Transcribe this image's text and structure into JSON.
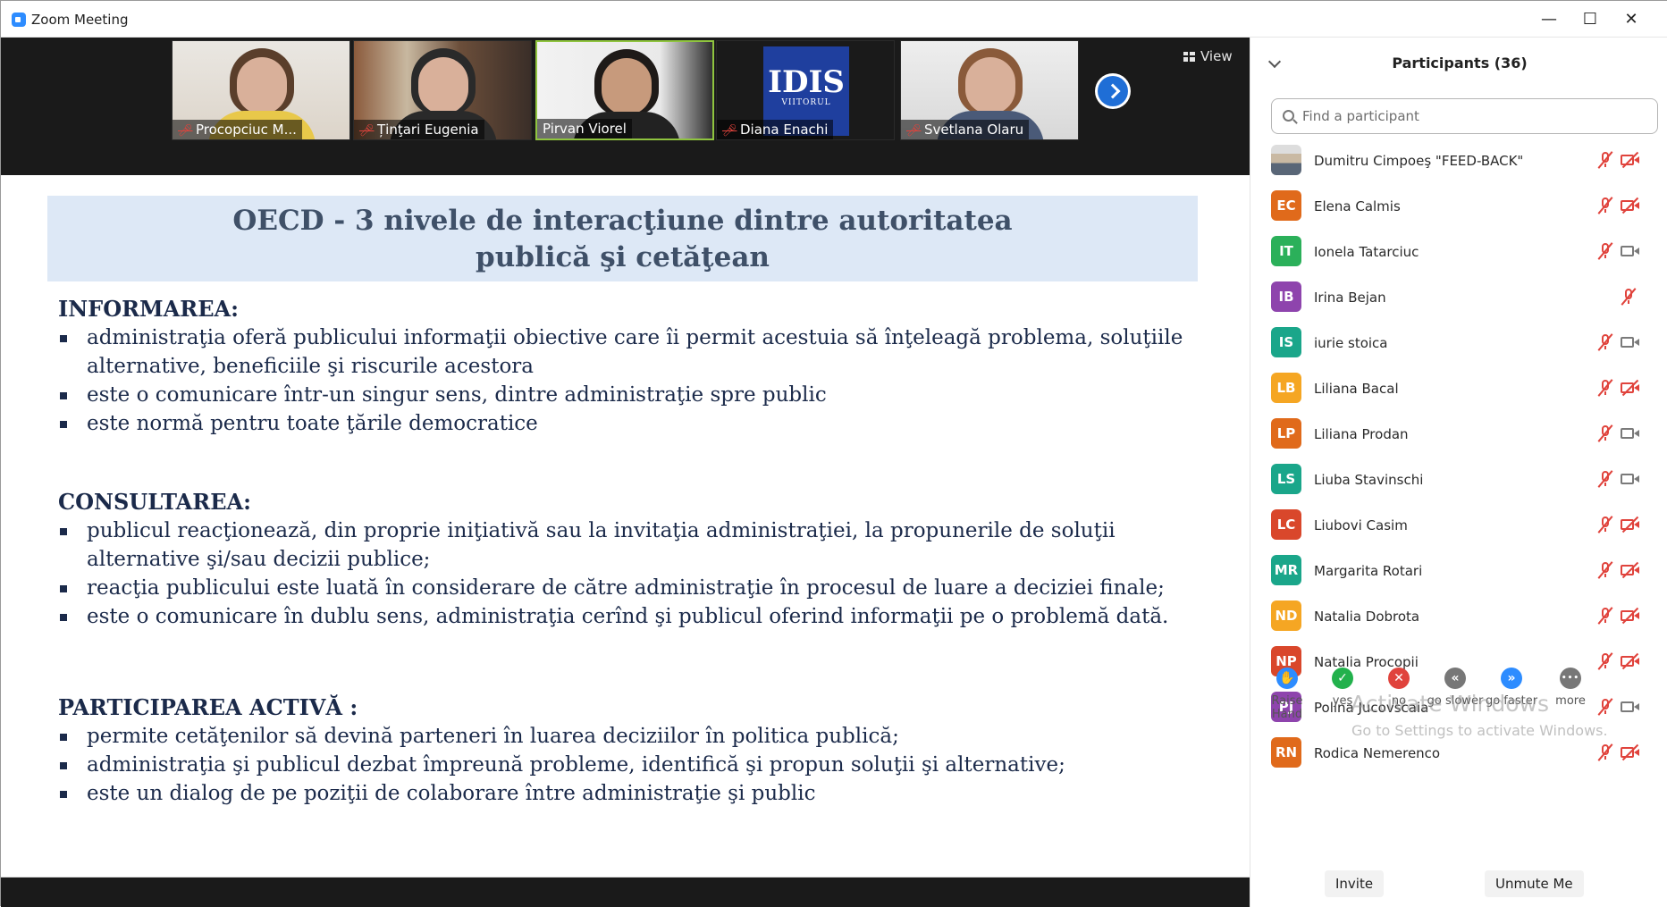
{
  "window": {
    "title": "Zoom Meeting",
    "minimize": "—",
    "maximize": "☐",
    "close": "✕"
  },
  "video_strip": {
    "view_label": "View",
    "tiles": [
      {
        "name": "Procopciuc M...",
        "muted": true
      },
      {
        "name": "Ținţari Eugenia",
        "muted": true
      },
      {
        "name": "Pirvan Viorel",
        "muted": false,
        "active": true
      },
      {
        "name": "Diana Enachi",
        "muted": true
      },
      {
        "name": "Svetlana Olaru",
        "muted": true
      }
    ],
    "logo_text": "IDIS",
    "logo_subtext": "VIITORUL"
  },
  "slide": {
    "title_line1": "OECD - 3 nivele de interacţiune dintre autoritatea",
    "title_line2": "publică şi cetăţean",
    "sections": [
      {
        "heading": "INFORMAREA:",
        "bullets": [
          "administraţia oferă publicului informaţii obiective care îi permit acestuia să înţeleagă problema, soluţiile alternative, beneficiile şi riscurile acestora",
          "este o comunicare într-un singur sens, dintre administraţie spre public",
          "este normă pentru toate ţările democratice"
        ]
      },
      {
        "heading": "CONSULTAREA:",
        "bullets": [
          "publicul reacţionează, din proprie iniţiativă sau la invitaţia administraţiei, la propunerile de soluţii alternative şi/sau decizii publice;",
          "reacţia publicului este luată în considerare de către administraţie în procesul de luare a deciziei finale;",
          "este o comunicare în dublu sens, administraţia cerînd şi publicul oferind informaţii pe o problemă dată."
        ]
      },
      {
        "heading": "PARTICIPAREA ACTIVĂ :",
        "bullets": [
          "permite cetăţenilor să devină parteneri în luarea deciziilor în politica publică;",
          "administraţia şi publicul dezbat împreună probleme, identifică şi propun soluţii şi alternative;",
          "este un dialog de pe poziţii de colaborare între administraţie şi public"
        ]
      }
    ]
  },
  "participants": {
    "title": "Participants (36)",
    "search_placeholder": "Find a participant",
    "list": [
      {
        "initials": "",
        "name": "Dumitru Cimpoeş \"FEED-BACK\"",
        "color": "#888888",
        "photo": true,
        "mic_muted": true,
        "cam": "off"
      },
      {
        "initials": "EC",
        "name": "Elena Calmis",
        "color": "#e06a1b",
        "mic_muted": true,
        "cam": "off"
      },
      {
        "initials": "IT",
        "name": "Ionela Tatarciuc",
        "color": "#2bb05a",
        "mic_muted": true,
        "cam": "on"
      },
      {
        "initials": "IB",
        "name": "Irina Bejan",
        "color": "#8e44ad",
        "mic_muted": true,
        "cam": "none"
      },
      {
        "initials": "IS",
        "name": "iurie stoica",
        "color": "#1aa68a",
        "mic_muted": true,
        "cam": "on"
      },
      {
        "initials": "LB",
        "name": "Liliana Bacal",
        "color": "#f5a623",
        "mic_muted": true,
        "cam": "off"
      },
      {
        "initials": "LP",
        "name": "Liliana Prodan",
        "color": "#e06a1b",
        "mic_muted": true,
        "cam": "on"
      },
      {
        "initials": "LS",
        "name": "Liuba Stavinschi",
        "color": "#1aa68a",
        "mic_muted": true,
        "cam": "on"
      },
      {
        "initials": "LC",
        "name": "Liubovi Casim",
        "color": "#d9472b",
        "mic_muted": true,
        "cam": "off"
      },
      {
        "initials": "MR",
        "name": "Margarita Rotari",
        "color": "#1aa68a",
        "mic_muted": true,
        "cam": "off"
      },
      {
        "initials": "ND",
        "name": "Natalia Dobrota",
        "color": "#f5a623",
        "mic_muted": true,
        "cam": "off"
      },
      {
        "initials": "NP",
        "name": "Natalia Procopii",
        "color": "#d9472b",
        "mic_muted": true,
        "cam": "off"
      },
      {
        "initials": "PJ",
        "name": "Polina Jucovscaia",
        "color": "#8e44ad",
        "mic_muted": true,
        "cam": "on"
      },
      {
        "initials": "RN",
        "name": "Rodica Nemerenco",
        "color": "#e06a1b",
        "mic_muted": true,
        "cam": "off"
      }
    ],
    "reactions": [
      {
        "label": "Raise Hand",
        "icon": "raise-hand-icon",
        "glyph": "✋",
        "color": "#2d8cff"
      },
      {
        "label": "yes",
        "icon": "check-icon",
        "glyph": "✓",
        "color": "#22b14c"
      },
      {
        "label": "no",
        "icon": "x-icon",
        "glyph": "✕",
        "color": "#e0433c"
      },
      {
        "label": "go slower",
        "icon": "rewind-icon",
        "glyph": "«",
        "color": "#777777"
      },
      {
        "label": "go faster",
        "icon": "fast-forward-icon",
        "glyph": "»",
        "color": "#2d8cff"
      },
      {
        "label": "more",
        "icon": "more-icon",
        "glyph": "•••",
        "color": "#777777"
      }
    ],
    "watermark_line1": "Activate Windows",
    "watermark_line2": "Go to Settings to activate Windows.",
    "invite_label": "Invite",
    "unmute_label": "Unmute Me"
  },
  "colors": {
    "accent": "#2d8cff",
    "muted_red": "#e0433c",
    "slide_title_bg": "#dde8f6",
    "slide_text": "#1b2a4a"
  }
}
